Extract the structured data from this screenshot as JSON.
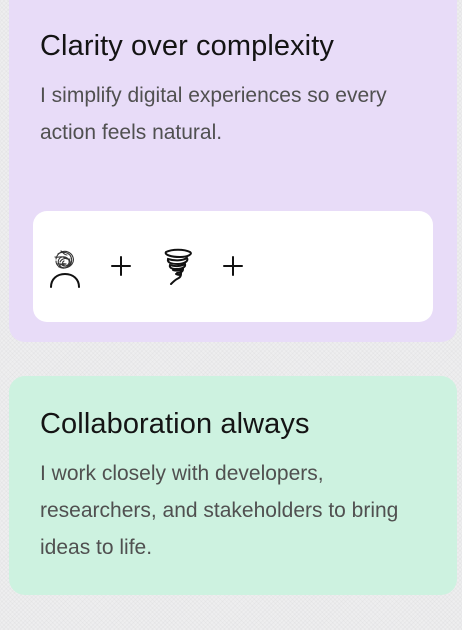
{
  "cards": [
    {
      "title": "Clarity over complexity",
      "body": "I simplify digital experiences so every action feels natural.",
      "icons": [
        "scribble-head-person-icon",
        "plus-icon",
        "tornado-swirl-icon",
        "plus-icon"
      ],
      "background": "#e8dcf8"
    },
    {
      "title": "Collaboration always",
      "body": "I work closely with developers, researchers, and stakeholders to bring ideas to life.",
      "background": "#cdf2e0"
    }
  ]
}
